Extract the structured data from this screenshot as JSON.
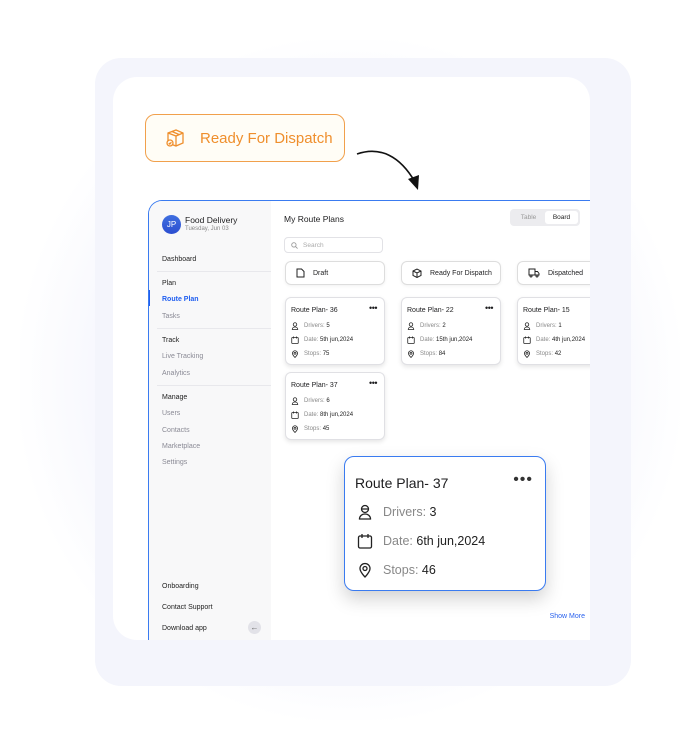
{
  "callout": {
    "label": "Ready For Dispatch",
    "color": "#ef8f2d"
  },
  "sidebar": {
    "avatar": "JP",
    "org": "Food Delivery",
    "date": "Tuesday, Jun 03",
    "dashboard": "Dashboard",
    "plan": {
      "heading": "Plan",
      "items": [
        "Route Plan",
        "Tasks"
      ]
    },
    "track": {
      "heading": "Track",
      "items": [
        "Live Tracking",
        "Analytics"
      ]
    },
    "manage": {
      "heading": "Manage",
      "items": [
        "Users",
        "Contacts",
        "Marketplace",
        "Settings"
      ]
    },
    "bottom": [
      "Onboarding",
      "Contact Support",
      "Download app"
    ]
  },
  "main": {
    "title": "My Route Plans",
    "view_toggle": [
      "Table",
      "Board"
    ],
    "active_view": "Board",
    "search_placeholder": "Search",
    "columns": [
      "Draft",
      "Ready For Dispatch",
      "Dispatched"
    ],
    "cards": [
      {
        "title": "Route Plan- 36",
        "drivers": "5",
        "date": "5th jun,2024",
        "stops": "75"
      },
      {
        "title": "Route Plan- 37",
        "drivers": "6",
        "date": "8th jun,2024",
        "stops": "45"
      },
      {
        "title": "Route Plan- 22",
        "drivers": "2",
        "date": "15th jun,2024",
        "stops": "84"
      },
      {
        "title": "Route Plan- 15",
        "drivers": "1",
        "date": "4th jun,2024",
        "stops": "42"
      }
    ],
    "labels": {
      "drivers": "Drivers:",
      "date": "Date:",
      "stops": "Stops:",
      "more": "•••"
    },
    "show_more": "Show More"
  },
  "popup": {
    "title": "Route Plan- 37",
    "drivers": "3",
    "date": "6th jun,2024",
    "stops": "46"
  },
  "accent": "#1f5ef0"
}
